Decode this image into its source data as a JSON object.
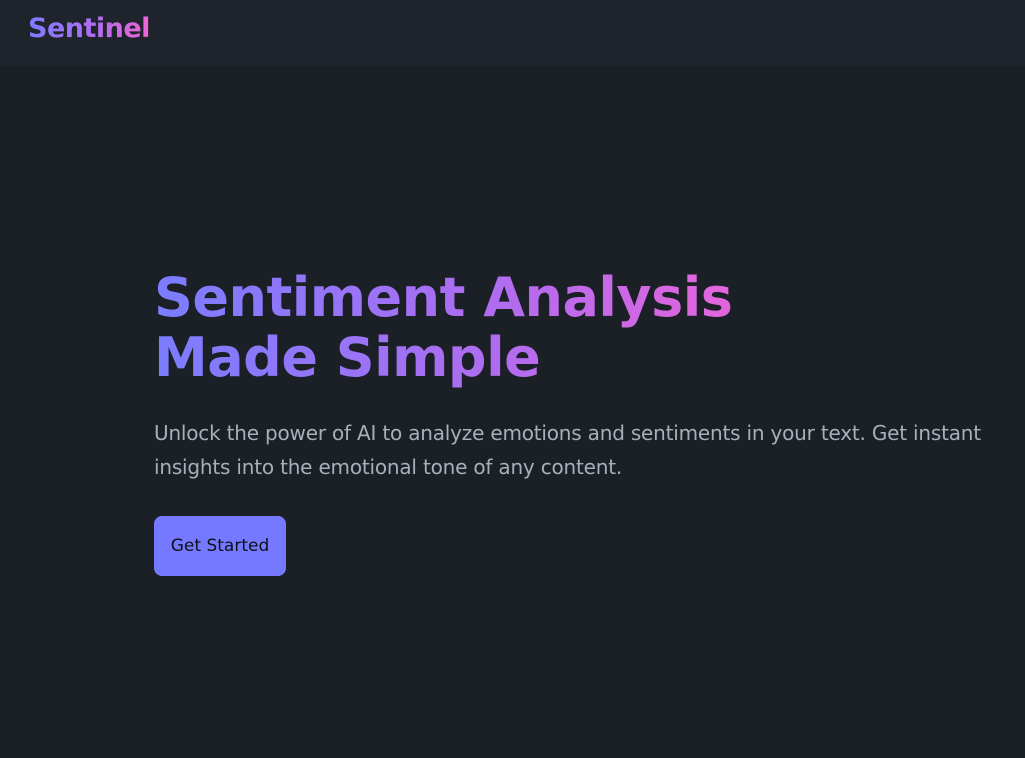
{
  "nav": {
    "brand": "Sentinel"
  },
  "hero": {
    "title": "Sentiment Analysis Made Simple",
    "subtitle": "Unlock the power of AI to analyze emotions and sentiments in your text. Get instant insights into the emotional tone of any content.",
    "cta_label": "Get Started"
  },
  "colors": {
    "background": "#1b1f26",
    "navbar": "#1f242c",
    "gradient_start": "#7b7dff",
    "gradient_end": "#f263d6",
    "button": "#7479ff",
    "body_text": "#a9aeb8"
  }
}
